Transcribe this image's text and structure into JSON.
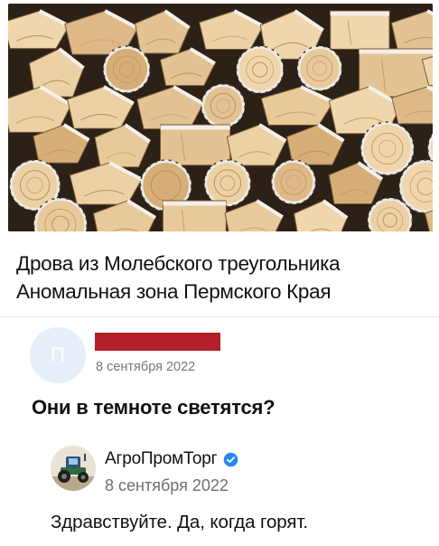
{
  "post": {
    "image_alt": "firewood-stack-photo",
    "caption_line1": "Дрова из Молебского треугольника",
    "caption_line2": "Аномальная зона Пермского Края"
  },
  "comment": {
    "avatar_letter": "П",
    "author_redacted_color": "#b3202a",
    "date": "8 сентября 2022",
    "text": "Они в темноте светятся?"
  },
  "reply": {
    "author": "АгроПромТорг",
    "verified": true,
    "date": "8 сентября 2022",
    "text": "Здравствуйте. Да, когда горят."
  },
  "colors": {
    "verified_badge": "#2787f5",
    "avatar_bg": "#e6eef8",
    "redaction": "#b3202a"
  }
}
